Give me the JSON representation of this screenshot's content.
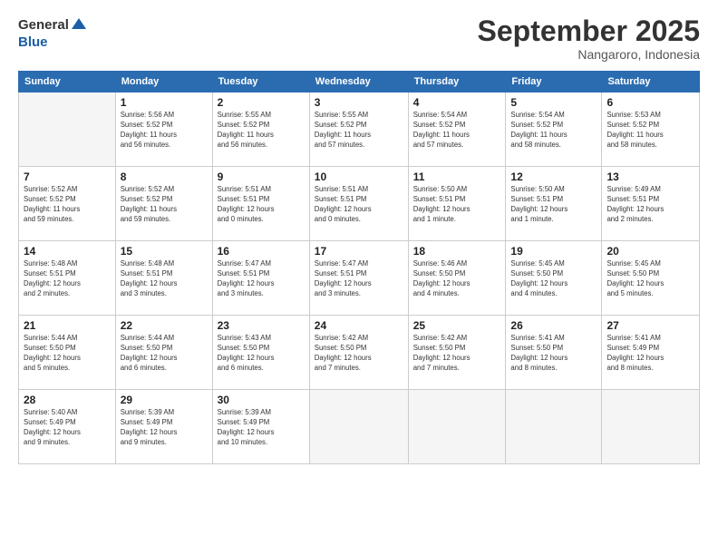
{
  "header": {
    "logo_line1": "General",
    "logo_line2": "Blue",
    "title": "September 2025",
    "subtitle": "Nangaroro, Indonesia"
  },
  "days_of_week": [
    "Sunday",
    "Monday",
    "Tuesday",
    "Wednesday",
    "Thursday",
    "Friday",
    "Saturday"
  ],
  "weeks": [
    [
      {
        "day": "",
        "info": ""
      },
      {
        "day": "1",
        "info": "Sunrise: 5:56 AM\nSunset: 5:52 PM\nDaylight: 11 hours\nand 56 minutes."
      },
      {
        "day": "2",
        "info": "Sunrise: 5:55 AM\nSunset: 5:52 PM\nDaylight: 11 hours\nand 56 minutes."
      },
      {
        "day": "3",
        "info": "Sunrise: 5:55 AM\nSunset: 5:52 PM\nDaylight: 11 hours\nand 57 minutes."
      },
      {
        "day": "4",
        "info": "Sunrise: 5:54 AM\nSunset: 5:52 PM\nDaylight: 11 hours\nand 57 minutes."
      },
      {
        "day": "5",
        "info": "Sunrise: 5:54 AM\nSunset: 5:52 PM\nDaylight: 11 hours\nand 58 minutes."
      },
      {
        "day": "6",
        "info": "Sunrise: 5:53 AM\nSunset: 5:52 PM\nDaylight: 11 hours\nand 58 minutes."
      }
    ],
    [
      {
        "day": "7",
        "info": "Sunrise: 5:52 AM\nSunset: 5:52 PM\nDaylight: 11 hours\nand 59 minutes."
      },
      {
        "day": "8",
        "info": "Sunrise: 5:52 AM\nSunset: 5:52 PM\nDaylight: 11 hours\nand 59 minutes."
      },
      {
        "day": "9",
        "info": "Sunrise: 5:51 AM\nSunset: 5:51 PM\nDaylight: 12 hours\nand 0 minutes."
      },
      {
        "day": "10",
        "info": "Sunrise: 5:51 AM\nSunset: 5:51 PM\nDaylight: 12 hours\nand 0 minutes."
      },
      {
        "day": "11",
        "info": "Sunrise: 5:50 AM\nSunset: 5:51 PM\nDaylight: 12 hours\nand 1 minute."
      },
      {
        "day": "12",
        "info": "Sunrise: 5:50 AM\nSunset: 5:51 PM\nDaylight: 12 hours\nand 1 minute."
      },
      {
        "day": "13",
        "info": "Sunrise: 5:49 AM\nSunset: 5:51 PM\nDaylight: 12 hours\nand 2 minutes."
      }
    ],
    [
      {
        "day": "14",
        "info": "Sunrise: 5:48 AM\nSunset: 5:51 PM\nDaylight: 12 hours\nand 2 minutes."
      },
      {
        "day": "15",
        "info": "Sunrise: 5:48 AM\nSunset: 5:51 PM\nDaylight: 12 hours\nand 3 minutes."
      },
      {
        "day": "16",
        "info": "Sunrise: 5:47 AM\nSunset: 5:51 PM\nDaylight: 12 hours\nand 3 minutes."
      },
      {
        "day": "17",
        "info": "Sunrise: 5:47 AM\nSunset: 5:51 PM\nDaylight: 12 hours\nand 3 minutes."
      },
      {
        "day": "18",
        "info": "Sunrise: 5:46 AM\nSunset: 5:50 PM\nDaylight: 12 hours\nand 4 minutes."
      },
      {
        "day": "19",
        "info": "Sunrise: 5:45 AM\nSunset: 5:50 PM\nDaylight: 12 hours\nand 4 minutes."
      },
      {
        "day": "20",
        "info": "Sunrise: 5:45 AM\nSunset: 5:50 PM\nDaylight: 12 hours\nand 5 minutes."
      }
    ],
    [
      {
        "day": "21",
        "info": "Sunrise: 5:44 AM\nSunset: 5:50 PM\nDaylight: 12 hours\nand 5 minutes."
      },
      {
        "day": "22",
        "info": "Sunrise: 5:44 AM\nSunset: 5:50 PM\nDaylight: 12 hours\nand 6 minutes."
      },
      {
        "day": "23",
        "info": "Sunrise: 5:43 AM\nSunset: 5:50 PM\nDaylight: 12 hours\nand 6 minutes."
      },
      {
        "day": "24",
        "info": "Sunrise: 5:42 AM\nSunset: 5:50 PM\nDaylight: 12 hours\nand 7 minutes."
      },
      {
        "day": "25",
        "info": "Sunrise: 5:42 AM\nSunset: 5:50 PM\nDaylight: 12 hours\nand 7 minutes."
      },
      {
        "day": "26",
        "info": "Sunrise: 5:41 AM\nSunset: 5:50 PM\nDaylight: 12 hours\nand 8 minutes."
      },
      {
        "day": "27",
        "info": "Sunrise: 5:41 AM\nSunset: 5:49 PM\nDaylight: 12 hours\nand 8 minutes."
      }
    ],
    [
      {
        "day": "28",
        "info": "Sunrise: 5:40 AM\nSunset: 5:49 PM\nDaylight: 12 hours\nand 9 minutes."
      },
      {
        "day": "29",
        "info": "Sunrise: 5:39 AM\nSunset: 5:49 PM\nDaylight: 12 hours\nand 9 minutes."
      },
      {
        "day": "30",
        "info": "Sunrise: 5:39 AM\nSunset: 5:49 PM\nDaylight: 12 hours\nand 10 minutes."
      },
      {
        "day": "",
        "info": ""
      },
      {
        "day": "",
        "info": ""
      },
      {
        "day": "",
        "info": ""
      },
      {
        "day": "",
        "info": ""
      }
    ]
  ]
}
